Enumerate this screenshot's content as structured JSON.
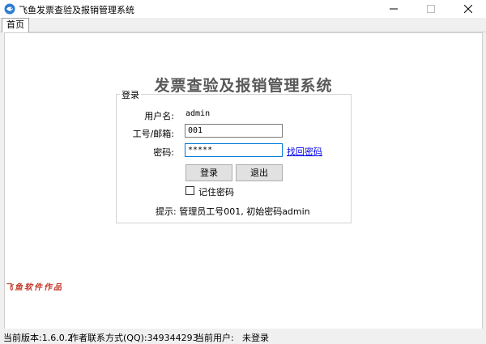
{
  "window": {
    "title": "飞鱼发票查验及报销管理系统"
  },
  "tabs": [
    {
      "label": "首页"
    }
  ],
  "main": {
    "title": "发票查验及报销管理系统"
  },
  "login": {
    "group_label": "登录",
    "username_label": "用户名:",
    "username_value": "admin",
    "id_label": "工号/邮箱:",
    "id_value": "001",
    "password_label": "密码:",
    "password_value": "*****",
    "retrieve_link": "找回密码",
    "login_button": "登录",
    "exit_button": "退出",
    "remember_label": "记住密码",
    "remember_checked": false,
    "hint": "提示: 管理员工号001, 初始密码admin"
  },
  "brand": "飞鱼软件作品",
  "status": {
    "version": "当前版本:1.6.0.2",
    "contact": "作者联系方式(QQ):349344293",
    "user_label": "当前用户:",
    "user_value": "未登录"
  },
  "icons": {
    "app": "app-icon",
    "minimize": "minimize-icon",
    "maximize": "maximize-icon",
    "close": "close-icon"
  },
  "colors": {
    "accent": "#0078d7",
    "link": "#0000ee",
    "brand": "#c0392b",
    "title": "#595959"
  }
}
